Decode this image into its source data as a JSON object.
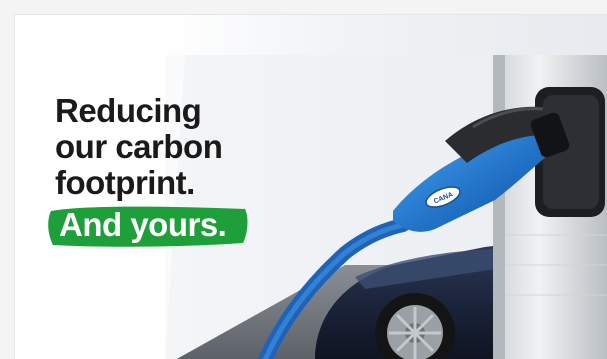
{
  "headline": {
    "line1": "Reducing",
    "line2": "our carbon",
    "line3": "footprint.",
    "highlight": "And yours."
  },
  "connector": {
    "logo_text": "CANA"
  },
  "colors": {
    "brand_green": "#1e9f3a",
    "connector_blue": "#2a7fd6",
    "text": "#1a1a1a"
  },
  "icons": [
    "ev-charger-image"
  ]
}
